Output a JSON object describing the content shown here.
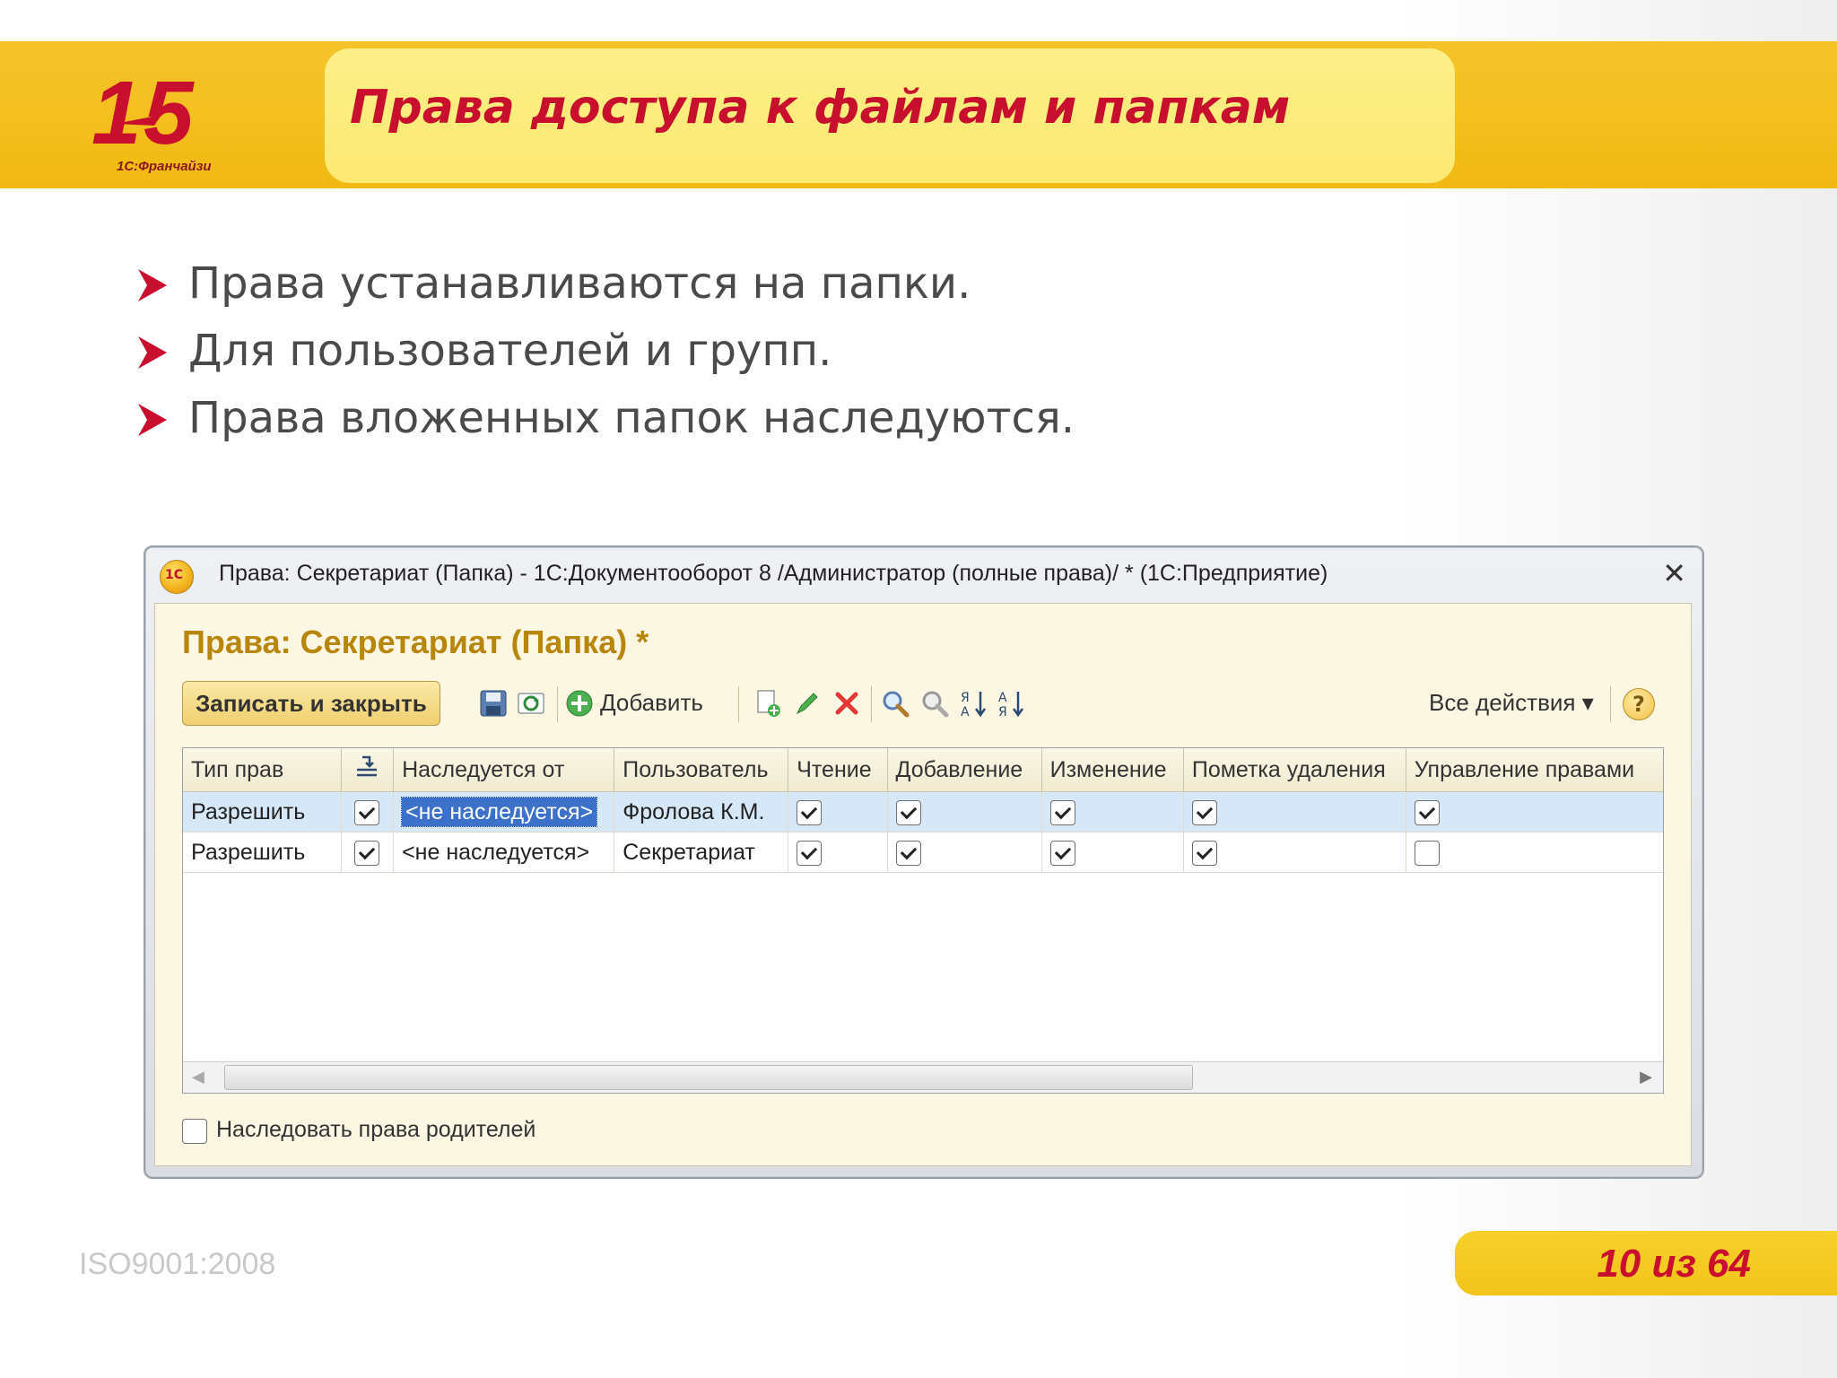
{
  "slide": {
    "title": "Права доступа к файлам и папкам",
    "logo_caption": "1С:Франчайзи",
    "bullets": [
      "Права устанавливаются на папки.",
      "Для пользователей и групп.",
      "Права вложенных папок наследуются."
    ],
    "iso": "ISO9001:2008",
    "page_indicator": "10 из 64"
  },
  "window": {
    "title": "Права: Секретариат (Папка) - 1С:Документооборот 8 /Администратор (полные права)/ *  (1С:Предприятие)",
    "close_glyph": "✕",
    "form_title": "Права: Секретариат (Папка) *",
    "toolbar": {
      "save_close_label": "Записать и закрыть",
      "add_label": "Добавить",
      "all_actions_label": "Все действия ▾",
      "help_glyph": "?"
    },
    "table": {
      "columns": [
        "Тип прав",
        "",
        "Наследуется от",
        "Пользователь",
        "Чтение",
        "Добавление",
        "Изменение",
        "Пометка удаления",
        "Управление правами"
      ],
      "rows": [
        {
          "type": "Разрешить",
          "flag": true,
          "inherited_from": "<не наследуется>",
          "user": "Фролова К.М.",
          "read": true,
          "add": true,
          "edit": true,
          "mark_delete": true,
          "manage": true
        },
        {
          "type": "Разрешить",
          "flag": true,
          "inherited_from": "<не наследуется>",
          "user": "Секретариат",
          "read": true,
          "add": true,
          "edit": true,
          "mark_delete": true,
          "manage": false
        }
      ]
    },
    "inherit_parent_label": "Наследовать права родителей",
    "inherit_parent_checked": false
  },
  "colors": {
    "brand_red": "#c8102e",
    "band_yellow": "#f4c01f",
    "form_title": "#b8860b",
    "selection": "#3c71c9"
  }
}
